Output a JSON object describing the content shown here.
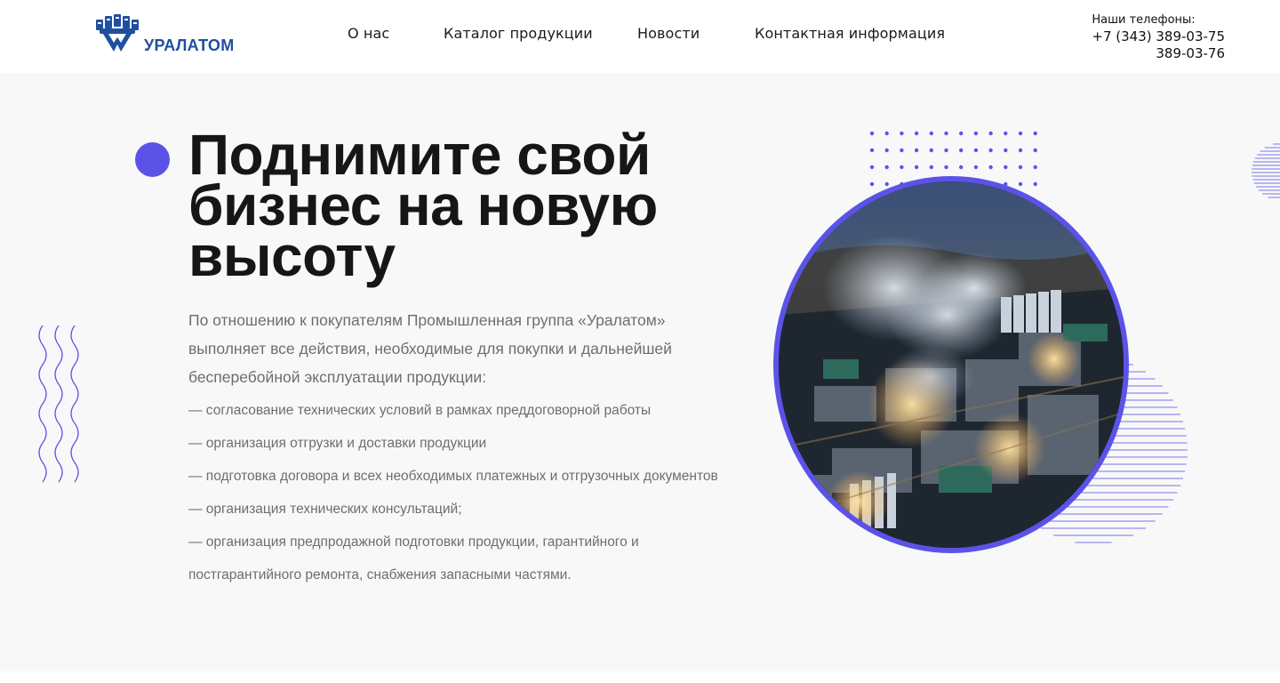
{
  "brand": {
    "logo_text": "УРАЛАТОМ",
    "accent": "#5b53e8",
    "logo_color": "#1f4fa0"
  },
  "nav": {
    "items": [
      {
        "label": "О нас"
      },
      {
        "label": "Каталог продукции"
      },
      {
        "label": "Новости"
      },
      {
        "label": "Контактная информация"
      }
    ]
  },
  "contacts": {
    "label": "Наши телефоны:",
    "phone1": "+7 (343) 389-03-75",
    "phone2": "389-03-76"
  },
  "hero": {
    "title": "Поднимите свой бизнес на новую высоту",
    "lead": "По отношению к покупателям Промышленная группа «Уралатом» выполняет все действия, необходимые для покупки и дальнейшей бесперебойной эксплуатации продукции:",
    "list": [
      "— согласование технических условий в рамках преддоговорной работы",
      "— организация отгрузки и доставки продукции",
      "— подготовка договора и всех необходимых платежных и отгрузочных документов",
      "— организация технических консультаций;",
      "— организация предпродажной подготовки продукции, гарантийного и постгарантийного ремонта, снабжения запасными частями."
    ]
  },
  "icons": {
    "bullet": "accent-circle",
    "waves": "decorative-wave-lines",
    "dots": "decorative-dot-grid",
    "stripes": "decorative-stripe-circle"
  }
}
